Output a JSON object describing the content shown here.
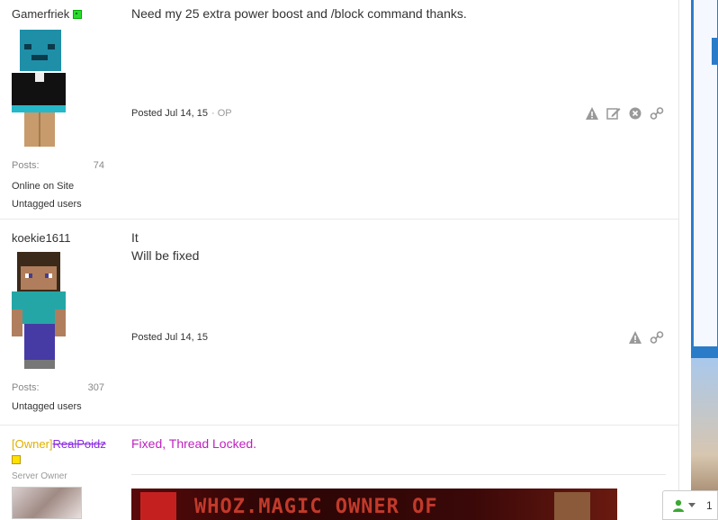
{
  "posts": [
    {
      "username": "Gamerfriek",
      "posts_label": "Posts:",
      "posts_count": "74",
      "online": "Online on Site",
      "tag": "Untagged users",
      "content": [
        "Need my 25 extra power boost and /block command thanks."
      ],
      "posted": "Posted Jul 14, 15",
      "op": "· OP"
    },
    {
      "username": "koekie1611",
      "posts_label": "Posts:",
      "posts_count": "307",
      "tag": "Untagged users",
      "content": [
        "It",
        "Will be fixed"
      ],
      "posted": "Posted Jul 14, 15"
    },
    {
      "username_prefix": "[Owner]",
      "username": "RealPoidz",
      "title": "Server Owner",
      "content": [
        "Fixed, Thread Locked."
      ],
      "banner_text": "WHOZ.MAGIC OWNER OF"
    }
  ],
  "widget": {
    "count": "1"
  },
  "colors": {
    "accent": "#2a7bc8",
    "admin": "#c020c0",
    "rank": "#e0b000"
  }
}
